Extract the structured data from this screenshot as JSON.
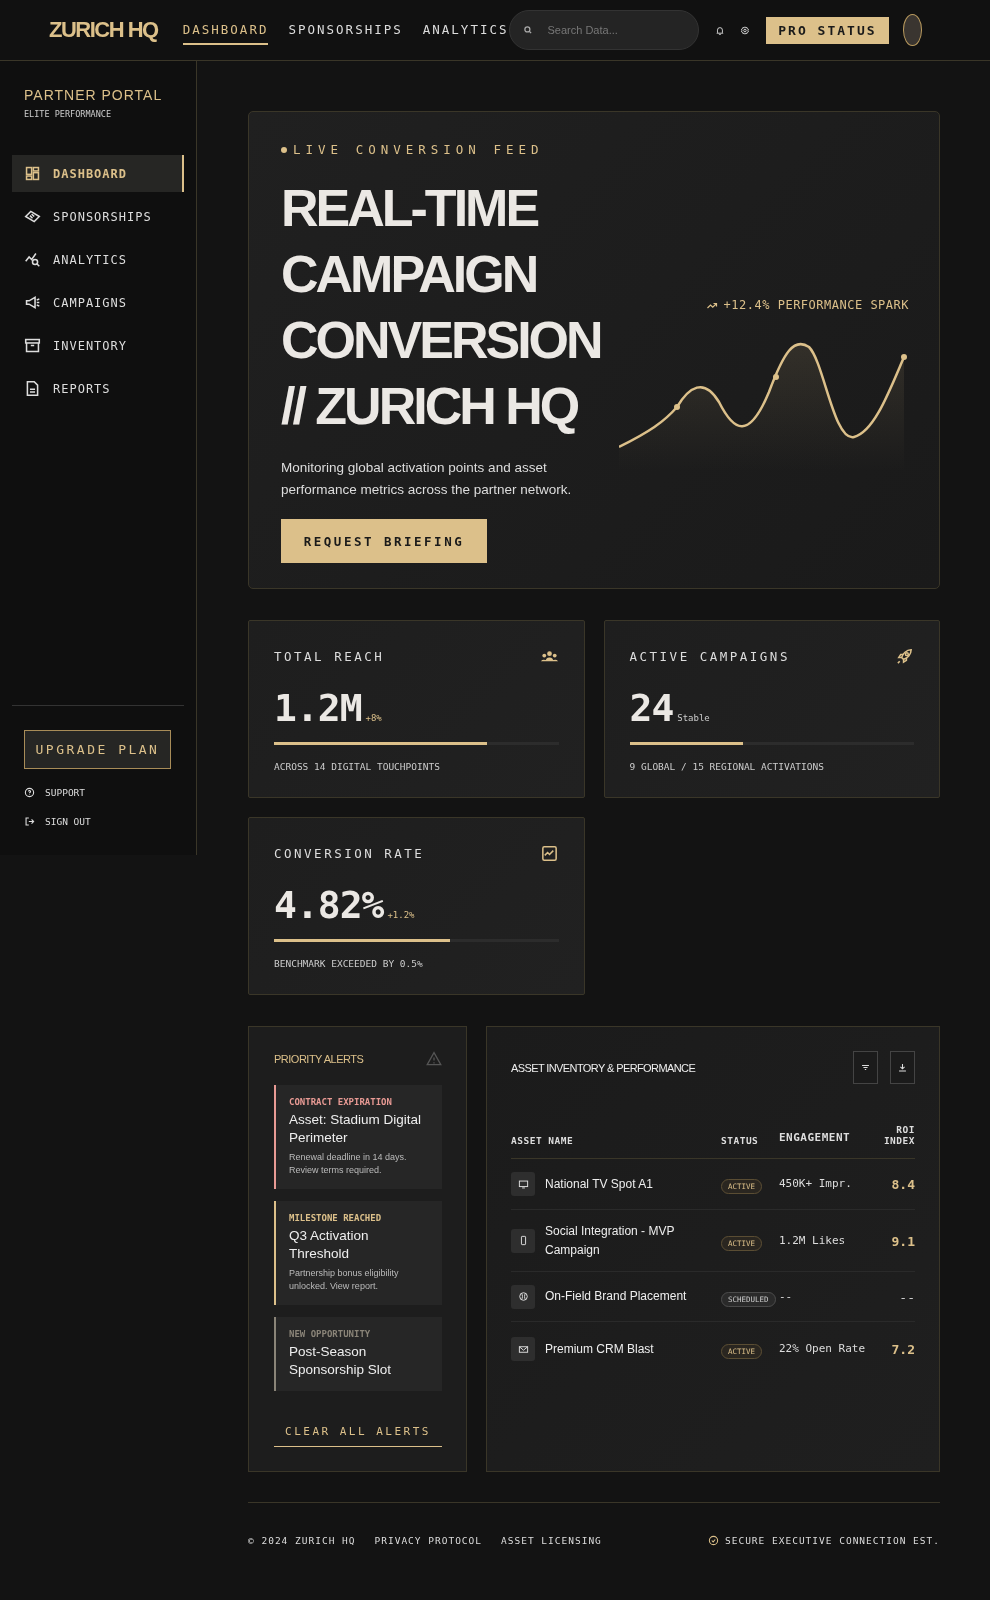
{
  "header": {
    "logo": "ZURICH HQ",
    "tabs": [
      {
        "label": "DASHBOARD",
        "selected": true
      },
      {
        "label": "SPONSORSHIPS",
        "selected": false
      },
      {
        "label": "ANALYTICS",
        "selected": false
      }
    ],
    "search": {
      "placeholder": "Search Data..."
    },
    "status_button": "PRO STATUS"
  },
  "sidebar": {
    "title": "PARTNER PORTAL",
    "subtitle": "ELITE PERFORMANCE",
    "items": [
      {
        "label": "DASHBOARD",
        "selected": true
      },
      {
        "label": "SPONSORSHIPS",
        "selected": false
      },
      {
        "label": "ANALYTICS",
        "selected": false
      },
      {
        "label": "CAMPAIGNS",
        "selected": false
      },
      {
        "label": "INVENTORY",
        "selected": false
      },
      {
        "label": "REPORTS",
        "selected": false
      }
    ],
    "upgrade_button": "UPGRADE PLAN",
    "links": [
      "SUPPORT",
      "SIGN OUT"
    ]
  },
  "hero": {
    "eyebrow": "LIVE CONVERSION FEED",
    "title": [
      "REAL-TIME",
      "CAMPAIGN",
      "CONVERSION",
      "// ZURICH HQ"
    ],
    "description": "Monitoring global activation points and asset performance metrics across the partner network.",
    "button": "REQUEST BRIEFING",
    "spark_label": "+12.4% PERFORMANCE SPARK"
  },
  "stats": [
    {
      "label": "TOTAL REACH",
      "value": "1.2M",
      "delta": "+8%",
      "kind": "up",
      "level": 0.75,
      "caption": "ACROSS 14 DIGITAL TOUCHPOINTS"
    },
    {
      "label": "ACTIVE CAMPAIGNS",
      "value": "24",
      "delta": "Stable",
      "kind": "flat",
      "level": 0.4,
      "caption": "9 GLOBAL / 15 REGIONAL ACTIVATIONS"
    },
    {
      "label": "CONVERSION RATE",
      "value": "4.82%",
      "delta": "+1.2%",
      "kind": "up",
      "level": 0.62,
      "caption": "BENCHMARK EXCEEDED BY 0.5%"
    }
  ],
  "alerts": {
    "title": "PRIORITY ALERTS",
    "items": [
      {
        "kind": "critical",
        "tag": "CONTRACT EXPIRATION",
        "title": "Asset: Stadium Digital Perimeter",
        "text": "Renewal deadline in 14 days. Review terms required."
      },
      {
        "kind": "milestone",
        "tag": "MILESTONE REACHED",
        "title": "Q3 Activation Threshold",
        "text": "Partnership bonus eligibility unlocked. View report."
      },
      {
        "kind": "opportunity",
        "tag": "NEW OPPORTUNITY",
        "title": "Post-Season Sponsorship Slot"
      }
    ],
    "clear_button": "CLEAR ALL ALERTS"
  },
  "inventory": {
    "title": "ASSET INVENTORY & PERFORMANCE",
    "columns": [
      "ASSET NAME",
      "STATUS",
      "ENGAGEMENT",
      "ROI INDEX"
    ],
    "rows": [
      {
        "name": "National TV Spot A1",
        "status": "ACTIVE",
        "kind": "active",
        "engagement": "450K+ Impr.",
        "roi": "8.4"
      },
      {
        "name": "Social Integration - MVP Campaign",
        "status": "ACTIVE",
        "kind": "active",
        "engagement": "1.2M Likes",
        "roi": "9.1"
      },
      {
        "name": "On-Field Brand Placement",
        "status": "SCHEDULED",
        "kind": "scheduled",
        "engagement": "--",
        "roi": "--"
      },
      {
        "name": "Premium CRM Blast",
        "status": "ACTIVE",
        "kind": "active",
        "engagement": "22% Open Rate",
        "roi": "7.2"
      }
    ]
  },
  "footer": {
    "copyright": "© 2024 ZURICH HQ",
    "links": [
      "PRIVACY PROTOCOL",
      "ASSET LICENSING"
    ],
    "secure": "SECURE EXECUTIVE CONNECTION EST."
  }
}
